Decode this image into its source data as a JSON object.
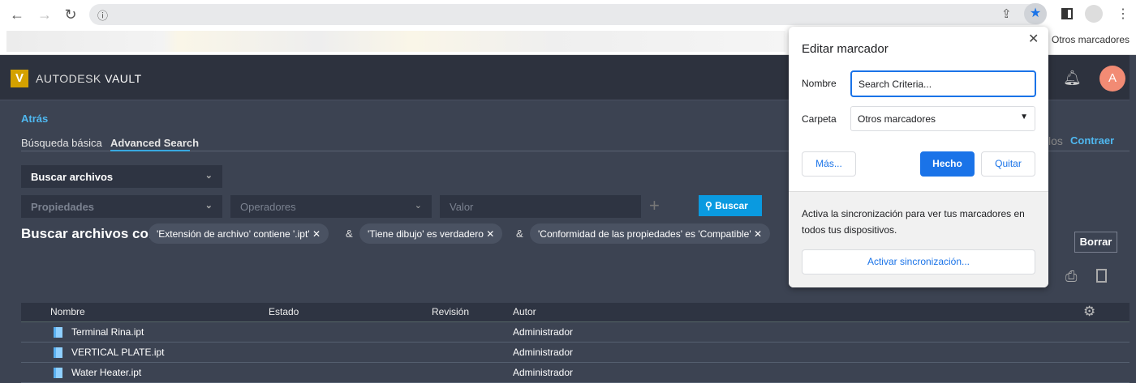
{
  "browser": {
    "bookmarks_other": "Otros marcadores"
  },
  "app": {
    "brand_prefix": "AUTODESK",
    "brand_name": "VAULT",
    "logo_letter": "V",
    "avatar": "A",
    "back": "Atrás",
    "tabs": [
      {
        "label": "Búsqueda básica"
      },
      {
        "label": "Advanced Search"
      }
    ],
    "partial_link": "los",
    "collapse": "Contraer",
    "search_type": "Buscar archivos",
    "properties_placeholder": "Propiedades",
    "operators_placeholder": "Operadores",
    "value_placeholder": "Valor",
    "search_button": "Buscar",
    "criteria_label": "Buscar archivos con",
    "criteria": [
      "'Extensión de archivo' contiene '.ipt'",
      "'Tiene dibujo' es verdadero",
      "'Conformidad de las propiedades' es 'Compatible'"
    ],
    "amp": "&",
    "clear": "Borrar",
    "table": {
      "columns": [
        "Nombre",
        "Estado",
        "Revisión",
        "Autor"
      ],
      "rows": [
        {
          "name": "Terminal Rina.ipt",
          "author": "Administrador"
        },
        {
          "name": "VERTICAL PLATE.ipt",
          "author": "Administrador"
        },
        {
          "name": "Water Heater.ipt",
          "author": "Administrador"
        }
      ]
    }
  },
  "popup": {
    "title": "Editar marcador",
    "name_label": "Nombre",
    "name_value": "Search Criteria...",
    "folder_label": "Carpeta",
    "folder_value": "Otros marcadores",
    "more": "Más...",
    "done": "Hecho",
    "remove": "Quitar",
    "sync_text": "Activa la sincronización para ver tus marcadores en todos tus dispositivos.",
    "sync_button": "Activar sincronización..."
  },
  "colors": {
    "accent": "#0a9ae0",
    "link": "#4fb8f0",
    "chrome_blue": "#1a73e8",
    "avatar": "#f28b74"
  }
}
